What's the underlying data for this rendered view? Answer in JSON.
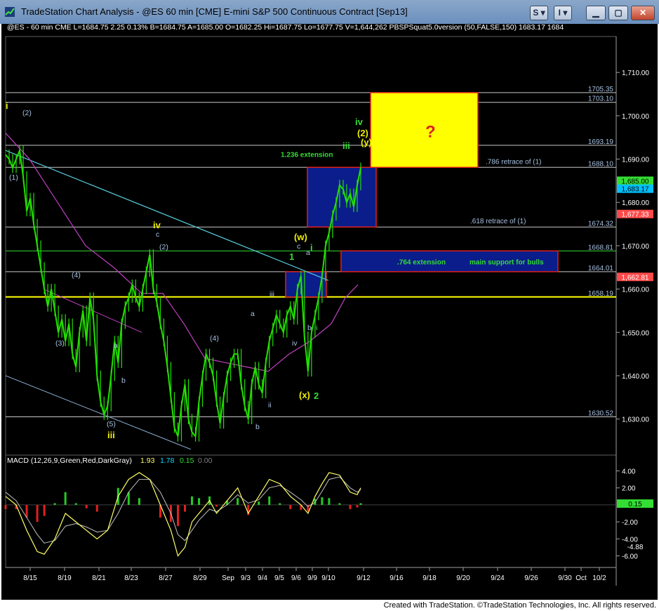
{
  "window": {
    "title": "TradeStation Chart Analysis - @ES 60 min [CME] E-mini S&P 500 Continuous Contract [Sep13]",
    "buttons": [
      "S",
      "I"
    ]
  },
  "footer": "Created with TradeStation. ©TradeStation Technologies, Inc. All rights reserved.",
  "colors": {
    "background": "#000000",
    "price": "#22e000",
    "grid_axis": "#808080",
    "hline": "#c8c8c8",
    "green_line": "#33dd33",
    "yellow_line": "#ffff00",
    "trend": "#57c9d8",
    "channel": "#8fb4d8",
    "ma": "#c040c0",
    "box_blue": "#0b1d8a",
    "box_border": "#e0201c",
    "box_yellow": "#ffff00",
    "label_blue": "#a7c0e0",
    "label_yellow": "#f0f000",
    "label_green": "#33dd33",
    "macd_line": "#ffff66",
    "macd_signal": "#c0c0c0"
  },
  "chart_data": {
    "type": "line",
    "symbol_line": "@ES - 60 min  CME  L=1684.75  2.25  0.13%   B=1684.75  A=1685.00  O=1682.25  Hi=1687.75  Lo=1677.75  V=1,644,262  PBSPSquat5.0version (50,FALSE,150)  1683.17  1684",
    "x_ticks": [
      "8/15",
      "8/19",
      "8/21",
      "8/23",
      "8/27",
      "8/29",
      "Sep",
      "9/3",
      "9/4",
      "9/5",
      "9/6",
      "9/9",
      "9/10",
      "9/12",
      "9/16",
      "9/18",
      "9/20",
      "9/24",
      "9/26",
      "9/30",
      "Oct",
      "10/2"
    ],
    "ylim": [
      1622,
      1717
    ],
    "y_ticks": [
      "1,630.00",
      "1,640.00",
      "1,650.00",
      "1,660.00",
      "1,670.00",
      "1,680.00",
      "1,690.00",
      "1,700.00",
      "1,710.00"
    ],
    "series": [
      {
        "values": [
          [
            0,
            1691
          ],
          [
            2,
            1690
          ],
          [
            4,
            1688
          ],
          [
            6,
            1690
          ],
          [
            8,
            1692
          ],
          [
            10,
            1686
          ],
          [
            12,
            1678
          ],
          [
            14,
            1681
          ],
          [
            16,
            1675
          ],
          [
            18,
            1670
          ],
          [
            20,
            1665
          ],
          [
            22,
            1660
          ],
          [
            24,
            1656
          ],
          [
            26,
            1660
          ],
          [
            28,
            1655
          ],
          [
            30,
            1650
          ],
          [
            32,
            1653
          ],
          [
            34,
            1648
          ],
          [
            36,
            1652
          ],
          [
            38,
            1645
          ],
          [
            40,
            1642
          ],
          [
            42,
            1650
          ],
          [
            44,
            1655
          ],
          [
            46,
            1648
          ],
          [
            48,
            1658
          ],
          [
            50,
            1653
          ],
          [
            52,
            1640
          ],
          [
            54,
            1634
          ],
          [
            56,
            1631
          ],
          [
            58,
            1633
          ],
          [
            60,
            1640
          ],
          [
            62,
            1648
          ],
          [
            64,
            1643
          ],
          [
            66,
            1652
          ],
          [
            68,
            1656
          ],
          [
            70,
            1658
          ],
          [
            72,
            1661
          ],
          [
            74,
            1658
          ],
          [
            76,
            1656
          ],
          [
            78,
            1660
          ],
          [
            80,
            1664
          ],
          [
            82,
            1668
          ],
          [
            84,
            1660
          ],
          [
            86,
            1657
          ],
          [
            88,
            1652
          ],
          [
            90,
            1648
          ],
          [
            92,
            1642
          ],
          [
            94,
            1635
          ],
          [
            96,
            1628
          ],
          [
            98,
            1626
          ],
          [
            100,
            1633
          ],
          [
            102,
            1638
          ],
          [
            104,
            1630
          ],
          [
            106,
            1627
          ],
          [
            108,
            1626
          ],
          [
            110,
            1634
          ],
          [
            112,
            1640
          ],
          [
            114,
            1645
          ],
          [
            116,
            1643
          ],
          [
            118,
            1640
          ],
          [
            120,
            1634
          ],
          [
            122,
            1629
          ],
          [
            124,
            1635
          ],
          [
            126,
            1640
          ],
          [
            128,
            1643
          ],
          [
            130,
            1645
          ],
          [
            132,
            1645
          ],
          [
            134,
            1638
          ],
          [
            136,
            1633
          ],
          [
            138,
            1630
          ],
          [
            140,
            1638
          ],
          [
            142,
            1642
          ],
          [
            144,
            1638
          ],
          [
            146,
            1636
          ],
          [
            148,
            1643
          ],
          [
            150,
            1648
          ],
          [
            152,
            1651
          ],
          [
            154,
            1654
          ],
          [
            156,
            1652
          ],
          [
            158,
            1650
          ],
          [
            160,
            1654
          ],
          [
            162,
            1656
          ],
          [
            164,
            1653
          ],
          [
            166,
            1660
          ],
          [
            168,
            1663
          ],
          [
            170,
            1649
          ],
          [
            172,
            1641
          ],
          [
            174,
            1650
          ],
          [
            176,
            1654
          ],
          [
            178,
            1658
          ],
          [
            180,
            1663
          ],
          [
            182,
            1670
          ],
          [
            184,
            1673
          ],
          [
            186,
            1677
          ],
          [
            188,
            1680
          ],
          [
            190,
            1684
          ],
          [
            192,
            1683
          ],
          [
            194,
            1680
          ],
          [
            196,
            1682
          ],
          [
            198,
            1679
          ],
          [
            200,
            1684
          ],
          [
            202,
            1688
          ]
        ]
      }
    ],
    "macd": {
      "title": "MACD (12,26,9,Green,Red,DarkGray)",
      "values": [
        "1.93",
        "1.78",
        "0.15",
        "0.00"
      ],
      "ylim": [
        -7.2,
        5.2
      ],
      "y_ticks": [
        "4.00",
        "2.00",
        "-2.00",
        "-4.00",
        "-6.00"
      ],
      "value_tags": [
        "0.15",
        "-4.88"
      ],
      "line": [
        [
          0,
          1
        ],
        [
          6,
          0
        ],
        [
          12,
          -3
        ],
        [
          18,
          -5.5
        ],
        [
          22,
          -5.8
        ],
        [
          28,
          -4
        ],
        [
          34,
          -1
        ],
        [
          40,
          -2
        ],
        [
          46,
          -3
        ],
        [
          52,
          -4
        ],
        [
          58,
          -3
        ],
        [
          64,
          1
        ],
        [
          70,
          3
        ],
        [
          76,
          3.8
        ],
        [
          82,
          3
        ],
        [
          88,
          0
        ],
        [
          94,
          -3
        ],
        [
          98,
          -6
        ],
        [
          102,
          -5
        ],
        [
          106,
          -2
        ],
        [
          110,
          -1
        ],
        [
          116,
          0.5
        ],
        [
          120,
          -1
        ],
        [
          126,
          0.5
        ],
        [
          132,
          2
        ],
        [
          138,
          -1
        ],
        [
          144,
          1
        ],
        [
          150,
          3
        ],
        [
          156,
          2.5
        ],
        [
          162,
          1
        ],
        [
          168,
          0
        ],
        [
          172,
          -1
        ],
        [
          176,
          1
        ],
        [
          180,
          2.5
        ],
        [
          184,
          3.8
        ],
        [
          190,
          3.5
        ],
        [
          196,
          1.5
        ],
        [
          200,
          1.2
        ],
        [
          202,
          2
        ]
      ],
      "signal": [
        [
          0,
          1.5
        ],
        [
          6,
          0.5
        ],
        [
          12,
          -1.5
        ],
        [
          18,
          -3.5
        ],
        [
          22,
          -4.5
        ],
        [
          28,
          -4.2
        ],
        [
          34,
          -2.5
        ],
        [
          40,
          -2.2
        ],
        [
          46,
          -2.6
        ],
        [
          52,
          -3.2
        ],
        [
          58,
          -3
        ],
        [
          64,
          -1
        ],
        [
          70,
          1.5
        ],
        [
          76,
          3
        ],
        [
          82,
          3
        ],
        [
          88,
          1.5
        ],
        [
          94,
          -1
        ],
        [
          98,
          -3.5
        ],
        [
          102,
          -4.2
        ],
        [
          106,
          -3
        ],
        [
          110,
          -1.8
        ],
        [
          116,
          -0.5
        ],
        [
          120,
          -0.8
        ],
        [
          126,
          0
        ],
        [
          132,
          1.2
        ],
        [
          138,
          0.2
        ],
        [
          144,
          0.6
        ],
        [
          150,
          2
        ],
        [
          156,
          2.3
        ],
        [
          162,
          1.5
        ],
        [
          168,
          0.6
        ],
        [
          172,
          -0.2
        ],
        [
          176,
          0.3
        ],
        [
          180,
          1.6
        ],
        [
          184,
          3
        ],
        [
          190,
          3.3
        ],
        [
          196,
          2
        ],
        [
          200,
          1.5
        ],
        [
          202,
          1.8
        ]
      ]
    },
    "horizontal_levels": [
      {
        "value": 1705.35,
        "label": "1705.35"
      },
      {
        "value": 1703.1,
        "label": "1703.10"
      },
      {
        "value": 1693.19,
        "label": "1693.19"
      },
      {
        "value": 1688.1,
        "label": "1688.10"
      },
      {
        "value": 1674.32,
        "label": "1674.32"
      },
      {
        "value": 1668.81,
        "label": "1668.81"
      },
      {
        "value": 1664.01,
        "label": "1664.01"
      },
      {
        "value": 1658.19,
        "label": "1658.19"
      },
      {
        "value": 1630.52,
        "label": "1630.52"
      }
    ],
    "price_tags": [
      "1,685.00",
      "1,683.17",
      "1,677.33",
      "1,662.81"
    ],
    "annotations": {
      "extension_1236": "1.236 extension",
      "retrace_786": ".786 retrace of (1)",
      "retrace_618": ".618 retrace of (1)",
      "extension_764": ".764 extension",
      "support": "main support for bulls",
      "question": "?"
    },
    "wave_labels": [
      {
        "text": "i",
        "color": "yellow"
      },
      {
        "text": "(2)",
        "color": "blue"
      },
      {
        "text": "(1)",
        "color": "blue"
      },
      {
        "text": "(4)",
        "color": "blue"
      },
      {
        "text": "(3)",
        "color": "blue"
      },
      {
        "text": "a",
        "color": "blue"
      },
      {
        "text": "b",
        "color": "blue"
      },
      {
        "text": "(5)",
        "color": "blue"
      },
      {
        "text": "iii",
        "color": "yellow"
      },
      {
        "text": "iv",
        "color": "yellow"
      },
      {
        "text": "c",
        "color": "blue"
      },
      {
        "text": "(2)",
        "color": "blue"
      },
      {
        "text": "(4)",
        "color": "blue"
      },
      {
        "text": "a",
        "color": "blue"
      },
      {
        "text": "b",
        "color": "blue"
      },
      {
        "text": "ii",
        "color": "blue"
      },
      {
        "text": "iii",
        "color": "blue"
      },
      {
        "text": "iv",
        "color": "blue"
      },
      {
        "text": "1",
        "color": "green"
      },
      {
        "text": "(w)",
        "color": "yellow"
      },
      {
        "text": "c",
        "color": "blue"
      },
      {
        "text": "a",
        "color": "blue"
      },
      {
        "text": "i",
        "color": "green"
      },
      {
        "text": "b",
        "color": "blue"
      },
      {
        "text": "ii",
        "color": "green"
      },
      {
        "text": "(x)",
        "color": "yellow"
      },
      {
        "text": "2",
        "color": "green"
      },
      {
        "text": "iii",
        "color": "green"
      },
      {
        "text": "iv",
        "color": "green"
      },
      {
        "text": "(2)",
        "color": "yellow"
      },
      {
        "text": "(y)",
        "color": "yellow"
      },
      {
        "text": "c",
        "color": "blue"
      }
    ]
  }
}
